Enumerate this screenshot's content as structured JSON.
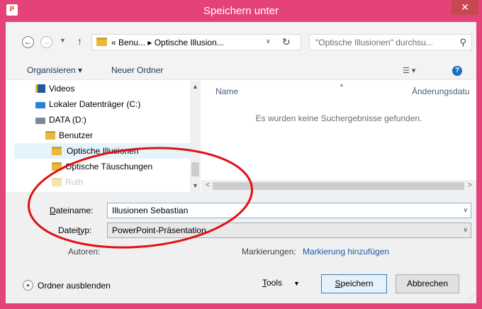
{
  "window": {
    "title": "Speichern unter",
    "app_icon_text": "P"
  },
  "address": {
    "path": "« Benu... ▸ Optische Illusion...",
    "search_placeholder": "\"Optische Illusionen\" durchsu..."
  },
  "toolbar": {
    "organize_label": "Organisieren ▾",
    "new_folder_label": "Neuer Ordner"
  },
  "tree": {
    "items": [
      {
        "label": "Videos"
      },
      {
        "label": "Lokaler Datenträger (C:)"
      },
      {
        "label": "DATA (D:)"
      },
      {
        "label": "Benutzer"
      },
      {
        "label": "Optische Illusionen"
      },
      {
        "label": "Optische Täuschungen"
      },
      {
        "label": "Ruth"
      }
    ]
  },
  "filelist": {
    "col_name": "Name",
    "col_date": "Änderungsdatu",
    "empty_message": "Es wurden keine Suchergebnisse gefunden."
  },
  "form": {
    "filename_label_u": "D",
    "filename_label_rest": "ateiname:",
    "filename_value": "Illusionen Sebastian",
    "filetype_label_pre": "Datei",
    "filetype_label_u": "t",
    "filetype_label_rest": "yp:",
    "filetype_value": "PowerPoint-Präsentation",
    "authors_label": "Autoren:",
    "tags_label": "Markierungen:",
    "tags_link": "Markierung hinzufügen"
  },
  "footer": {
    "hide_folders_label": "Ordner ausblenden",
    "tools_label_u": "T",
    "tools_label_rest": "ools",
    "save_label_u": "S",
    "save_label_rest": "peichern",
    "cancel_label": "Abbrechen"
  },
  "colors": {
    "title_bar": "#e4437a",
    "close_button": "#c7484f",
    "annotation": "#e01010",
    "link": "#1a5aa6"
  }
}
